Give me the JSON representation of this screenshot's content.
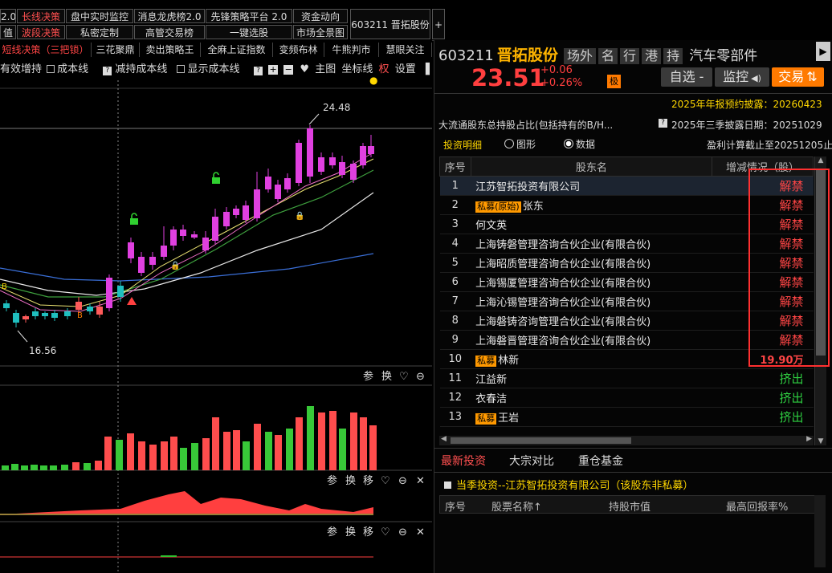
{
  "toolbar": {
    "row1": [
      {
        "label": "2.0"
      },
      {
        "label": "长线决策"
      },
      {
        "label": "盘中实时监控"
      },
      {
        "label": "消息龙虎榜2.0"
      },
      {
        "label": "先锋策略平台 2.0"
      },
      {
        "label": "资金动向"
      }
    ],
    "row2": [
      {
        "label": "值"
      },
      {
        "label": "波段决策"
      },
      {
        "label": "私密定制"
      },
      {
        "label": "高管交易榜"
      },
      {
        "label": "一键选股"
      },
      {
        "label": "市场全景图"
      }
    ],
    "active_stock": "603211 晋拓股份",
    "plus": "+"
  },
  "chart": {
    "options": {
      "opt1": "有效增持",
      "opt2": "成本线",
      "opt3": "减持成本线",
      "opt4": "显示成本线",
      "main": "主图",
      "axis": "坐标线",
      "quan": "权",
      "settings": "设置"
    },
    "strategy_tabs": [
      "短线决策（三把锁）",
      "三花聚鼎",
      "卖出策略王",
      "全麻上证指数",
      "变频布林",
      "牛熊判市",
      "慧眼关注"
    ],
    "high_label": "24.48",
    "low_label": "16.56",
    "panel_tools": {
      "ref": "参",
      "swap": "换",
      "move": "移"
    }
  },
  "stock": {
    "code": "603211",
    "name": "晋拓股份",
    "tags": [
      "场外",
      "名",
      "行",
      "港",
      "持"
    ],
    "industry": "汽车零部件",
    "price": "23.51",
    "change": "+0.06",
    "change_pct": "+0.26%",
    "ji_badge": "极",
    "btn_watch": "自选 -",
    "btn_monitor": "监控",
    "btn_trade": "交易"
  },
  "info": {
    "annual_report": "2025年年报预约披露：20260423",
    "holder_title": "大流通股东总持股占比(包括持有的B/H...",
    "q3_date": "2025年三季披露日期：20251029",
    "tab_detail": "投资明细",
    "radio_graph": "图形",
    "radio_data": "数据",
    "profit_date": "盈利计算截止至20251205止"
  },
  "holders_table": {
    "headers": [
      "序号",
      "股东名",
      "增减情况（股）"
    ],
    "rows": [
      {
        "no": "1",
        "tag": "",
        "name": "江苏智拓投资有限公司",
        "change": "解禁",
        "kind": "unlock"
      },
      {
        "no": "2",
        "tag": "私募(原始)",
        "name": "张东",
        "change": "解禁",
        "kind": "unlock"
      },
      {
        "no": "3",
        "tag": "",
        "name": "何文英",
        "change": "解禁",
        "kind": "unlock"
      },
      {
        "no": "4",
        "tag": "",
        "name": "上海铸磐管理咨询合伙企业(有限合伙)",
        "change": "解禁",
        "kind": "unlock"
      },
      {
        "no": "5",
        "tag": "",
        "name": "上海昭质管理咨询合伙企业(有限合伙)",
        "change": "解禁",
        "kind": "unlock"
      },
      {
        "no": "6",
        "tag": "",
        "name": "上海锡厦管理咨询合伙企业(有限合伙)",
        "change": "解禁",
        "kind": "unlock"
      },
      {
        "no": "7",
        "tag": "",
        "name": "上海沁锡管理咨询合伙企业(有限合伙)",
        "change": "解禁",
        "kind": "unlock"
      },
      {
        "no": "8",
        "tag": "",
        "name": "上海磐铸咨询管理合伙企业(有限合伙)",
        "change": "解禁",
        "kind": "unlock"
      },
      {
        "no": "9",
        "tag": "",
        "name": "上海磐晋管理咨询合伙企业(有限合伙)",
        "change": "解禁",
        "kind": "unlock"
      },
      {
        "no": "10",
        "tag": "私募",
        "name": "林新",
        "change": "19.90万",
        "kind": "amount"
      },
      {
        "no": "11",
        "tag": "",
        "name": "江益新",
        "change": "挤出",
        "kind": "out"
      },
      {
        "no": "12",
        "tag": "",
        "name": "衣春洁",
        "change": "挤出",
        "kind": "out"
      },
      {
        "no": "13",
        "tag": "私募",
        "name": "王岩",
        "change": "挤出",
        "kind": "out"
      }
    ]
  },
  "bottom": {
    "tabs": [
      "最新投资",
      "大宗对比",
      "重仓基金"
    ],
    "quarter_title": "当季投资--江苏智拓投资有限公司（该股东非私募）",
    "headers": [
      "序号",
      "股票名称↑",
      "持股市值",
      "最高回报率%"
    ]
  },
  "colors": {
    "up": "#ff3f3f",
    "down": "#2ecc40",
    "candle_magenta": "#e040e0",
    "accent": "#ff7a00"
  }
}
